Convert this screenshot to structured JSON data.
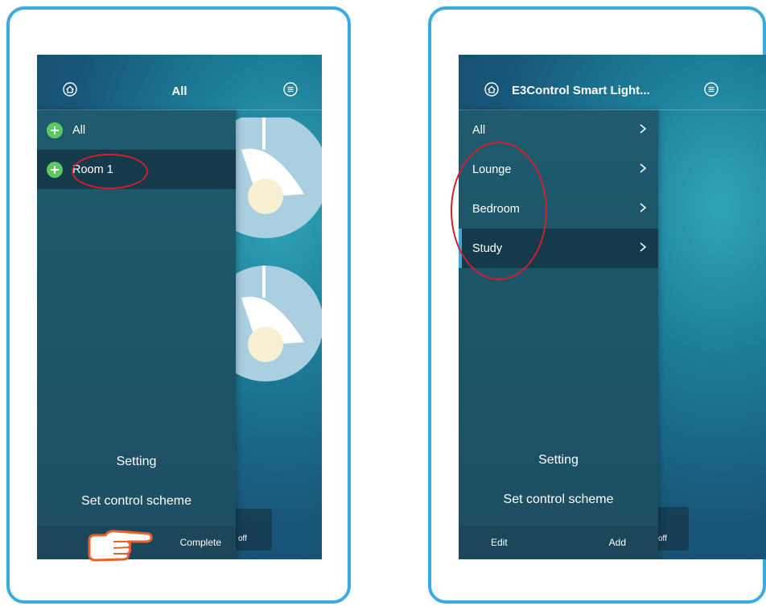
{
  "left": {
    "header": {
      "title": "All"
    },
    "groups": [
      {
        "label": "All"
      },
      {
        "label": "Room 1"
      }
    ],
    "setting_label": "Setting",
    "scheme_label": "Set control scheme",
    "bottom": {
      "complete_label": "Complete"
    },
    "underlay_button_text": "off"
  },
  "right": {
    "header": {
      "title": "E3Control Smart Light..."
    },
    "rooms": [
      {
        "label": "All"
      },
      {
        "label": "Lounge"
      },
      {
        "label": "Bedroom"
      },
      {
        "label": "Study"
      }
    ],
    "setting_label": "Setting",
    "scheme_label": "Set control scheme",
    "bottom": {
      "edit_label": "Edit",
      "add_label": "Add"
    },
    "underlay_button_text": "off"
  },
  "colors": {
    "frame_border": "#3aabe0",
    "annotation_red": "#d21f2b",
    "hand_orange": "#e8622b",
    "plus_green": "#5cc85f"
  },
  "icons": [
    "home-icon",
    "menu-icon",
    "plus-icon",
    "chevron-right-icon",
    "pointing-hand-icon",
    "pendant-lamp-icon"
  ]
}
